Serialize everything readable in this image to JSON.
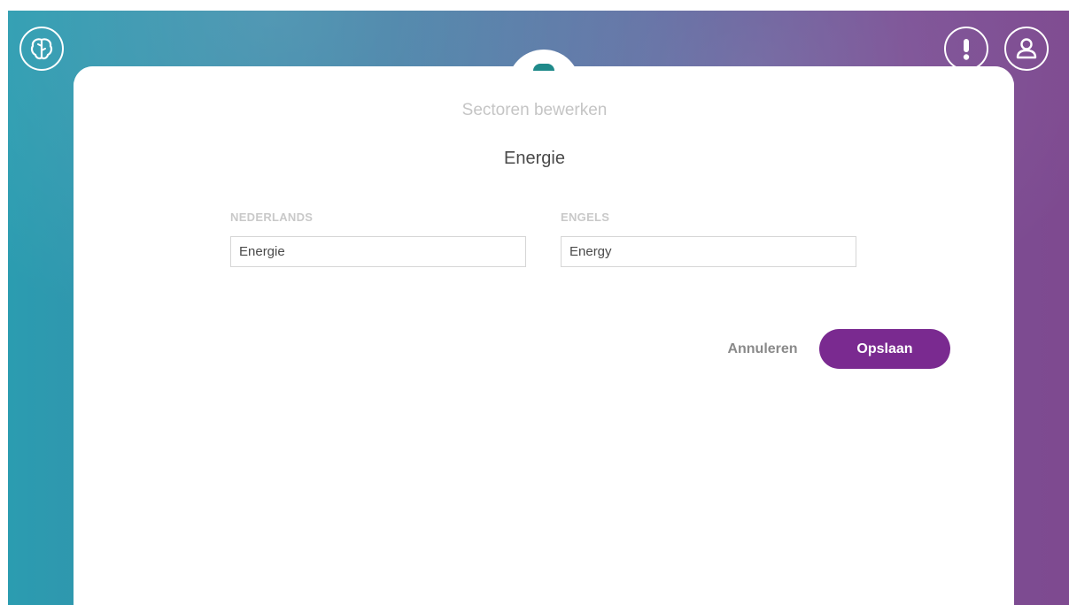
{
  "header": {
    "logo_icon": "brain-icon",
    "alert_icon": "exclamation-icon",
    "user_icon": "user-icon"
  },
  "dialog": {
    "title": "Sectoren bewerken",
    "subtitle": "Energie",
    "fields": [
      {
        "label": "NEDERLANDS",
        "value": "Energie"
      },
      {
        "label": "ENGELS",
        "value": "Energy"
      }
    ],
    "cancel_label": "Annuleren",
    "save_label": "Opslaan"
  },
  "colors": {
    "accent": "#7a2a90",
    "gradient_start": "#2b9cb0",
    "gradient_end": "#7e4a90",
    "badge": "#1f8a8a"
  }
}
